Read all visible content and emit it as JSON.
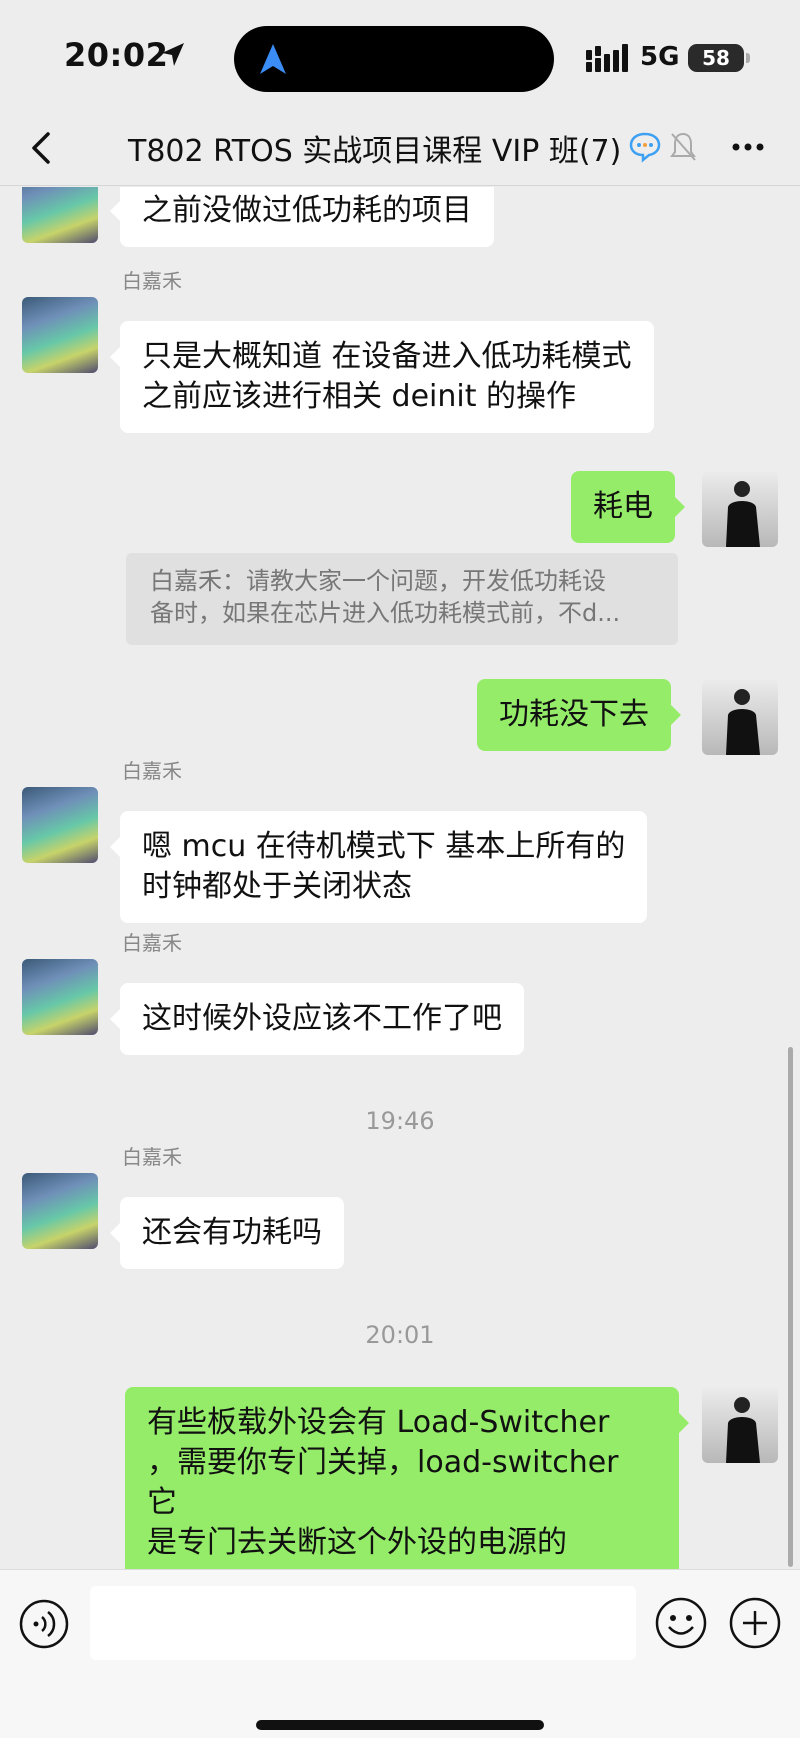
{
  "status": {
    "time": "20:02",
    "network": "5G",
    "battery": "58"
  },
  "header": {
    "title": "T802 RTOS 实战项目课程 VIP 班(7)"
  },
  "messages": [
    {
      "side": "left",
      "sender": "",
      "lines": [
        "之前没做过低功耗的项目"
      ]
    },
    {
      "side": "left",
      "sender": "白嘉禾",
      "lines": [
        "只是大概知道 在设备进入低功耗模式",
        "之前应该进行相关 deinit 的操作"
      ]
    },
    {
      "side": "right",
      "lines": [
        "耗电"
      ]
    },
    {
      "type": "quote",
      "lines": [
        "白嘉禾：请教大家一个问题，开发低功耗设",
        "备时，如果在芯片进入低功耗模式前，不d..."
      ]
    },
    {
      "side": "right",
      "lines": [
        "功耗没下去"
      ]
    },
    {
      "side": "left",
      "sender": "白嘉禾",
      "lines": [
        "嗯 mcu 在待机模式下 基本上所有的",
        "时钟都处于关闭状态"
      ]
    },
    {
      "side": "left",
      "sender": "白嘉禾",
      "lines": [
        "这时候外设应该不工作了吧"
      ]
    },
    {
      "type": "time",
      "text": "19:46"
    },
    {
      "side": "left",
      "sender": "白嘉禾",
      "lines": [
        "还会有功耗吗"
      ]
    },
    {
      "type": "time",
      "text": "20:01"
    },
    {
      "side": "right",
      "lines": [
        "有些板载外设会有 Load-Switcher",
        "，需要你专门关掉，load-switcher 它",
        "是专门去关断这个外设的电源的"
      ]
    }
  ],
  "colors": {
    "self_bubble": "#95ec69",
    "other_bubble": "#ffffff",
    "background": "#ededed"
  },
  "icons": [
    "location-arrow-icon",
    "navigation-icon",
    "signal-icon",
    "back-chevron-icon",
    "chat-bubble-icon",
    "mute-bell-icon",
    "more-icon",
    "voice-icon",
    "emoji-icon",
    "plus-icon"
  ]
}
